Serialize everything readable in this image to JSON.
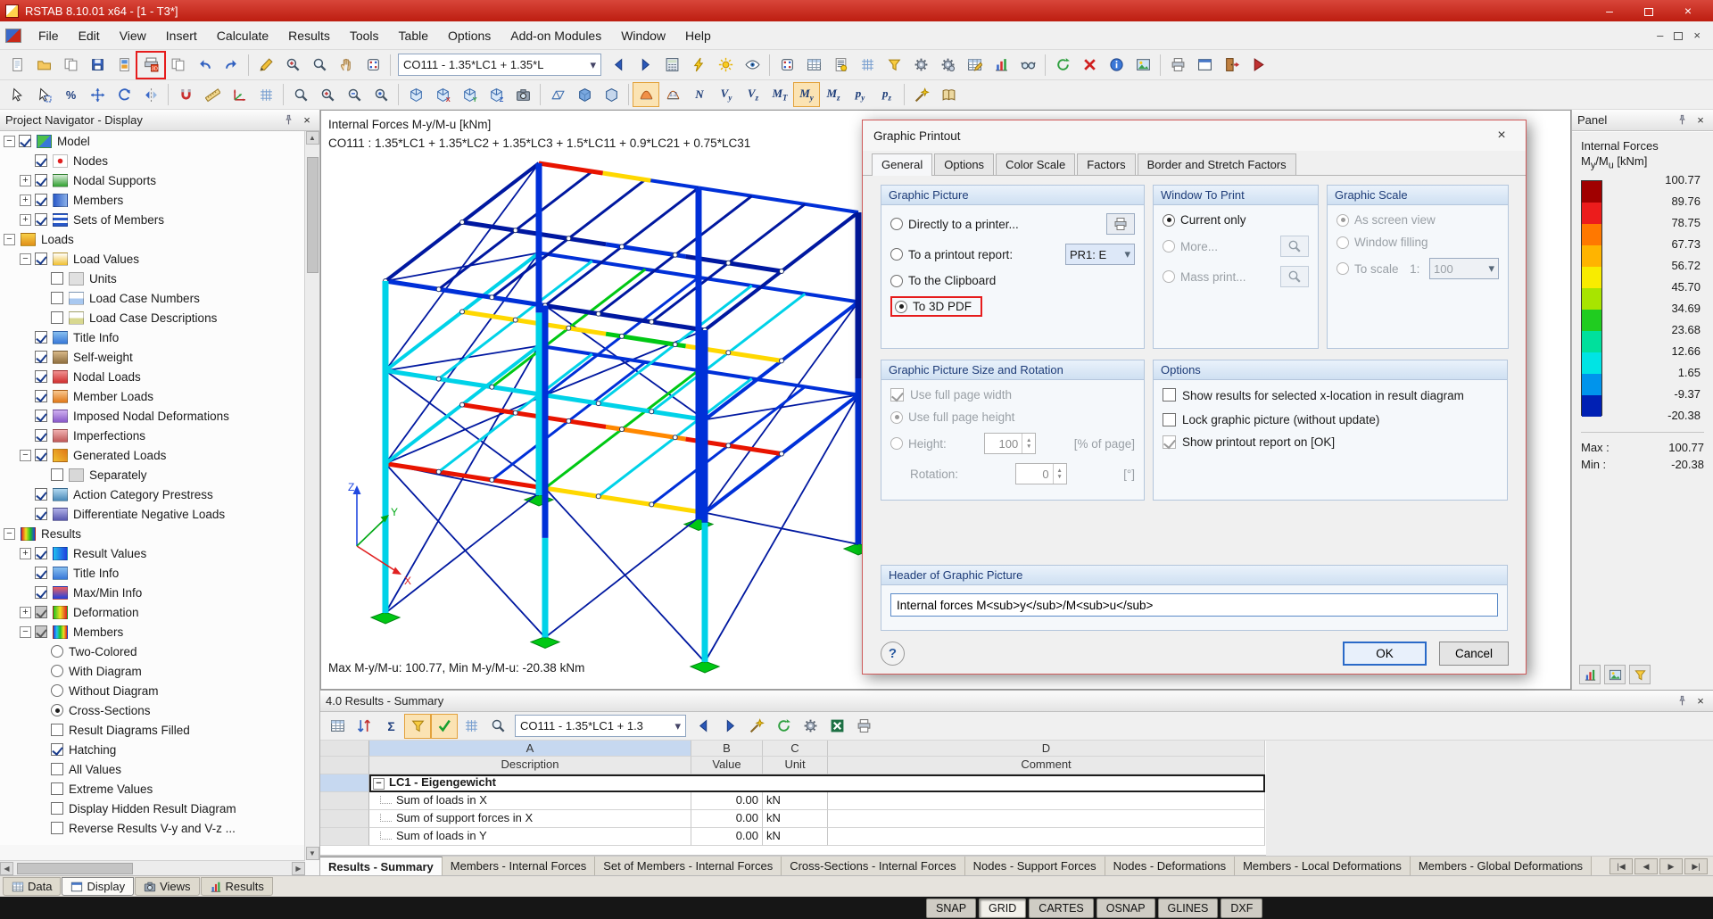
{
  "window": {
    "title": "RSTAB 8.10.01 x64 - [1 - T3*]"
  },
  "glyphs": {
    "close": "×",
    "minimize": "–",
    "dropdown": "▾",
    "left": "◀",
    "right": "▶",
    "up": "▲",
    "down": "▼",
    "plus": "+",
    "minus": "−",
    "help": "?",
    "tab_first": "|◀",
    "tab_prev": "◀",
    "tab_next": "▶",
    "tab_last": "▶|"
  },
  "menu": {
    "items": [
      "File",
      "Edit",
      "View",
      "Insert",
      "Calculate",
      "Results",
      "Tools",
      "Table",
      "Options",
      "Add-on Modules",
      "Window",
      "Help"
    ]
  },
  "toolbar1": [
    {
      "n": "new",
      "t": "page"
    },
    {
      "n": "open",
      "t": "folder"
    },
    {
      "n": "save-as",
      "t": "copy"
    },
    {
      "n": "save",
      "t": "disk"
    },
    {
      "n": "page-preview",
      "t": "pagecol"
    },
    {
      "n": "print-graphic",
      "t": "printg",
      "hl": true
    },
    {
      "n": "copy",
      "t": "copy2"
    },
    {
      "n": "undo",
      "t": "undo"
    },
    {
      "n": "redo",
      "t": "redo"
    },
    {
      "sep": true
    },
    {
      "n": "edit",
      "t": "pencil"
    },
    {
      "n": "zoom-in",
      "t": "magp"
    },
    {
      "n": "zoom-window",
      "t": "mag"
    },
    {
      "n": "pan",
      "t": "hand"
    },
    {
      "n": "numbering",
      "t": "dice"
    },
    {
      "sep": true
    },
    {
      "combo": "CO111 - 1.35*LC1 + 1.35*L"
    },
    {
      "n": "previous-load-case",
      "t": "arrl"
    },
    {
      "n": "next-load-case",
      "t": "arrr"
    },
    {
      "n": "calculation",
      "t": "calc"
    },
    {
      "n": "calculate-all",
      "t": "bolt"
    },
    {
      "n": "show-results",
      "t": "sun"
    },
    {
      "n": "show-result-values",
      "t": "eye"
    },
    {
      "sep": true
    },
    {
      "n": "load-cases",
      "t": "dice2"
    },
    {
      "n": "tables",
      "t": "table"
    },
    {
      "n": "printout-report",
      "t": "report"
    },
    {
      "n": "grid",
      "t": "grid"
    },
    {
      "n": "filter",
      "t": "filter"
    },
    {
      "n": "generate",
      "t": "gear"
    },
    {
      "n": "modules",
      "t": "gear2"
    },
    {
      "n": "edit-table",
      "t": "tablepen"
    },
    {
      "n": "diagram",
      "t": "chart"
    },
    {
      "n": "view-options",
      "t": "glasses"
    },
    {
      "sep": true
    },
    {
      "n": "refresh",
      "t": "refresh"
    },
    {
      "n": "delete-results",
      "t": "xred"
    },
    {
      "n": "info",
      "t": "info"
    },
    {
      "n": "render",
      "t": "img"
    },
    {
      "sep": true
    },
    {
      "n": "print",
      "t": "printer"
    },
    {
      "n": "window-arrange",
      "t": "win"
    },
    {
      "n": "exit",
      "t": "door"
    },
    {
      "n": "run-help",
      "t": "play"
    }
  ],
  "toolbar2": [
    {
      "n": "select",
      "t": "cursor"
    },
    {
      "n": "select-special",
      "t": "cursorbox"
    },
    {
      "n": "scale-percent",
      "t": "percent"
    },
    {
      "n": "move",
      "t": "moveax"
    },
    {
      "n": "rotate",
      "t": "rotate"
    },
    {
      "n": "mirror",
      "t": "mirror"
    },
    {
      "sep": true
    },
    {
      "n": "snap",
      "t": "magnet"
    },
    {
      "n": "guidelines",
      "t": "ruler"
    },
    {
      "n": "work-plane",
      "t": "axes"
    },
    {
      "n": "plane-grid",
      "t": "grid"
    },
    {
      "sep": true
    },
    {
      "n": "zoom",
      "t": "mag"
    },
    {
      "n": "zoom-plus",
      "t": "magp"
    },
    {
      "n": "zoom-minus",
      "t": "magm"
    },
    {
      "n": "previous-view",
      "t": "magl"
    },
    {
      "sep": true
    },
    {
      "n": "isometric-view",
      "t": "cube"
    },
    {
      "n": "view-in-x",
      "t": "cubex"
    },
    {
      "n": "view-in-y",
      "t": "cubey"
    },
    {
      "n": "view-in-z",
      "t": "cubez"
    },
    {
      "n": "user-view",
      "t": "camera"
    },
    {
      "sep": true
    },
    {
      "n": "wireframe-model",
      "t": "wire"
    },
    {
      "n": "solid-model",
      "t": "solid"
    },
    {
      "n": "transparent-model",
      "t": "glassbox"
    },
    {
      "sep": true
    },
    {
      "n": "result-diagrams",
      "t": "rdia",
      "on": true
    },
    {
      "n": "result-values",
      "t": "rval"
    },
    {
      "n": "component-n",
      "text": "N"
    },
    {
      "n": "component-vy",
      "text": "V_y"
    },
    {
      "n": "component-vz",
      "text": "V_z"
    },
    {
      "n": "component-mt",
      "text": "M_T"
    },
    {
      "n": "component-my",
      "text": "M_y",
      "on": true
    },
    {
      "n": "component-mz",
      "text": "M_z"
    },
    {
      "n": "component-py",
      "text": "p_y"
    },
    {
      "n": "component-pz",
      "text": "p_z"
    },
    {
      "sep": true
    },
    {
      "n": "animation",
      "t": "wand"
    },
    {
      "n": "manual",
      "t": "book"
    }
  ],
  "navigator": {
    "title": "Project Navigator - Display",
    "tree": [
      {
        "label": "Model",
        "level": 0,
        "exp": "minus",
        "ctrl": "check",
        "icon": "model"
      },
      {
        "label": "Nodes",
        "level": 1,
        "exp": "none",
        "ctrl": "check",
        "icon": "nodes"
      },
      {
        "label": "Nodal Supports",
        "level": 1,
        "exp": "plus",
        "ctrl": "check",
        "icon": "supports"
      },
      {
        "label": "Members",
        "level": 1,
        "exp": "plus",
        "ctrl": "check",
        "icon": "members"
      },
      {
        "label": "Sets of Members",
        "level": 1,
        "exp": "plus",
        "ctrl": "check",
        "icon": "sets"
      },
      {
        "label": "Loads",
        "level": 0,
        "exp": "minus",
        "ctrl": "none",
        "icon": "loads"
      },
      {
        "label": "Load Values",
        "level": 1,
        "exp": "minus",
        "ctrl": "check",
        "icon": "loadvalues"
      },
      {
        "label": "Units",
        "level": 2,
        "exp": "none",
        "ctrl": "uncheck",
        "icon": "units"
      },
      {
        "label": "Load Case Numbers",
        "level": 2,
        "exp": "none",
        "ctrl": "uncheck",
        "icon": "numbers"
      },
      {
        "label": "Load Case Descriptions",
        "level": 2,
        "exp": "none",
        "ctrl": "uncheck",
        "icon": "descriptions"
      },
      {
        "label": "Title Info",
        "level": 1,
        "exp": "none",
        "ctrl": "check",
        "icon": "info"
      },
      {
        "label": "Self-weight",
        "level": 1,
        "exp": "none",
        "ctrl": "check",
        "icon": "selfweight"
      },
      {
        "label": "Nodal Loads",
        "level": 1,
        "exp": "none",
        "ctrl": "check",
        "icon": "nodalloads"
      },
      {
        "label": "Member Loads",
        "level": 1,
        "exp": "none",
        "ctrl": "check",
        "icon": "memberloads"
      },
      {
        "label": "Imposed Nodal Deformations",
        "level": 1,
        "exp": "none",
        "ctrl": "check",
        "icon": "imposed"
      },
      {
        "label": "Imperfections",
        "level": 1,
        "exp": "none",
        "ctrl": "check",
        "icon": "imperfections"
      },
      {
        "label": "Generated Loads",
        "level": 1,
        "exp": "minus",
        "ctrl": "check",
        "icon": "generated"
      },
      {
        "label": "Separately",
        "level": 2,
        "exp": "none",
        "ctrl": "uncheck",
        "icon": "separately"
      },
      {
        "label": "Action Category Prestress",
        "level": 1,
        "exp": "none",
        "ctrl": "check",
        "icon": "prestress"
      },
      {
        "label": "Differentiate Negative Loads",
        "level": 1,
        "exp": "none",
        "ctrl": "check",
        "icon": "negative"
      },
      {
        "label": "Results",
        "level": 0,
        "exp": "minus",
        "ctrl": "none",
        "icon": "results"
      },
      {
        "label": "Result Values",
        "level": 1,
        "exp": "plus",
        "ctrl": "check",
        "icon": "resultvalues"
      },
      {
        "label": "Title Info",
        "level": 1,
        "exp": "none",
        "ctrl": "check",
        "icon": "info"
      },
      {
        "label": "Max/Min Info",
        "level": 1,
        "exp": "none",
        "ctrl": "check",
        "icon": "maxmin"
      },
      {
        "label": "Deformation",
        "level": 1,
        "exp": "plus",
        "ctrl": "partial",
        "icon": "deformation"
      },
      {
        "label": "Members",
        "level": 1,
        "exp": "minus",
        "ctrl": "partial",
        "icon": "membersres"
      },
      {
        "label": "Two-Colored",
        "level": 2,
        "exp": "none",
        "ctrl": "radio-off",
        "icon": null
      },
      {
        "label": "With Diagram",
        "level": 2,
        "exp": "none",
        "ctrl": "radio-off",
        "icon": null
      },
      {
        "label": "Without Diagram",
        "level": 2,
        "exp": "none",
        "ctrl": "radio-off",
        "icon": null
      },
      {
        "label": "Cross-Sections",
        "level": 2,
        "exp": "none",
        "ctrl": "radio-on",
        "icon": null
      },
      {
        "label": "Result Diagrams Filled",
        "level": 2,
        "exp": "none",
        "ctrl": "uncheck",
        "icon": null
      },
      {
        "label": "Hatching",
        "level": 2,
        "exp": "none",
        "ctrl": "check",
        "icon": null
      },
      {
        "label": "All Values",
        "level": 2,
        "exp": "none",
        "ctrl": "uncheck",
        "icon": null
      },
      {
        "label": "Extreme Values",
        "level": 2,
        "exp": "none",
        "ctrl": "uncheck",
        "icon": null
      },
      {
        "label": "Display Hidden Result Diagram",
        "level": 2,
        "exp": "none",
        "ctrl": "uncheck",
        "icon": null
      },
      {
        "label": "Reverse Results V-y and V-z ...",
        "level": 2,
        "exp": "none",
        "ctrl": "uncheck",
        "icon": null
      }
    ],
    "tabs": [
      {
        "label": "Data",
        "icon": "table"
      },
      {
        "label": "Display",
        "icon": "win",
        "active": true
      },
      {
        "label": "Views",
        "icon": "camera"
      },
      {
        "label": "Results",
        "icon": "chart"
      }
    ]
  },
  "viewport": {
    "info_line1": "Internal Forces M-y/M-u [kNm]",
    "info_line2": "CO111 : 1.35*LC1 + 1.35*LC2 + 1.35*LC3 + 1.5*LC11 + 0.9*LC21 + 0.75*LC31",
    "maxmin": "Max M-y/M-u: 100.77, Min M-y/M-u: -20.38 kNm"
  },
  "dialog": {
    "title": "Graphic Printout",
    "tabs": [
      {
        "label": "General",
        "active": true
      },
      {
        "label": "Options"
      },
      {
        "label": "Color Scale"
      },
      {
        "label": "Factors"
      },
      {
        "label": "Border and Stretch Factors"
      }
    ],
    "graphic_picture": {
      "title": "Graphic Picture",
      "directly": "Directly to a printer...",
      "report": "To a printout report:",
      "report_combo": "PR1: E",
      "clipboard": "To the Clipboard",
      "pdf3d": "To 3D PDF",
      "selected": "To 3D PDF"
    },
    "window_to_print": {
      "title": "Window To Print",
      "current": "Current only",
      "more": "More...",
      "mass": "Mass print...",
      "selected": "Current only"
    },
    "graphic_scale": {
      "title": "Graphic Scale",
      "screen": "As screen view",
      "filling": "Window filling",
      "scale": "To scale",
      "ratio": "1:",
      "value": "100",
      "selected": "As screen view"
    },
    "size_rotation": {
      "title": "Graphic Picture Size and Rotation",
      "full_width": "Use full page width",
      "full_height": "Use full page height",
      "height": "Height:",
      "height_value": "100",
      "height_unit": "[% of page]",
      "rotation": "Rotation:",
      "rotation_value": "0",
      "rotation_unit": "[°]"
    },
    "options": {
      "title": "Options",
      "xloc": "Show results for selected x-location in result diagram",
      "lock": "Lock graphic picture (without update)",
      "report_ok": "Show printout report on [OK]"
    },
    "header": {
      "title": "Header of Graphic Picture",
      "value": "Internal forces M<sub>y</sub>/M<sub>u</sub>"
    },
    "ok": "OK",
    "cancel": "Cancel"
  },
  "panel": {
    "title": "Panel",
    "result_type": "Internal Forces",
    "comp": {
      "m1": "M",
      "s1": "y",
      "m2": "/M",
      "s2": "u",
      "unit": " [kNm]"
    },
    "legend": {
      "labels": [
        "100.77",
        "89.76",
        "78.75",
        "67.73",
        "56.72",
        "45.70",
        "34.69",
        "23.68",
        "12.66",
        "1.65",
        "-9.37",
        "-20.38"
      ],
      "colors": [
        "#a00000",
        "#ec1c1c",
        "#ff7800",
        "#ffb400",
        "#f8ec00",
        "#a8e400",
        "#20cc20",
        "#00e09c",
        "#00e4e4",
        "#0094ec",
        "#0020b4"
      ]
    },
    "max_label": "Max :",
    "max_value": "100.77",
    "min_label": "Min :",
    "min_value": "-20.38",
    "buttons": [
      {
        "n": "panel-color-scale",
        "t": "chart"
      },
      {
        "n": "panel-display-options",
        "t": "img"
      },
      {
        "n": "panel-filter",
        "t": "filter"
      }
    ]
  },
  "results_pane": {
    "title": "4.0 Results - Summary",
    "toolbar": [
      {
        "n": "goto-table",
        "t": "table"
      },
      {
        "n": "sort-results",
        "t": "sort"
      },
      {
        "n": "sum-check",
        "t": "sigma"
      },
      {
        "n": "filter-rows",
        "t": "filter",
        "on": true
      },
      {
        "n": "highlight-results",
        "t": "check",
        "on": true
      },
      {
        "n": "column-settings",
        "t": "grid"
      },
      {
        "n": "find-in-table",
        "t": "mag"
      },
      {
        "combo": "CO111 - 1.35*LC1 + 1.3"
      },
      {
        "n": "previous-table",
        "t": "arrl"
      },
      {
        "n": "next-table",
        "t": "arrr"
      },
      {
        "n": "sync-graphic",
        "t": "wand"
      },
      {
        "n": "refresh-table",
        "t": "refresh"
      },
      {
        "n": "table-settings",
        "t": "gear"
      },
      {
        "n": "export-excel",
        "t": "excel"
      },
      {
        "n": "print-table",
        "t": "printer"
      }
    ],
    "table": {
      "letters": [
        "A",
        "B",
        "C",
        "D"
      ],
      "headers": [
        "Description",
        "Value",
        "Unit",
        "Comment"
      ],
      "group_row": "LC1 - Eigengewicht",
      "rows": [
        {
          "desc": "Sum of loads in X",
          "value": "0.00",
          "unit": "kN",
          "comment": ""
        },
        {
          "desc": "Sum of support forces in X",
          "value": "0.00",
          "unit": "kN",
          "comment": ""
        },
        {
          "desc": "Sum of loads in Y",
          "value": "0.00",
          "unit": "kN",
          "comment": ""
        }
      ]
    },
    "tabs": [
      "Results - Summary",
      "Members - Internal Forces",
      "Set of Members - Internal Forces",
      "Cross-Sections - Internal Forces",
      "Nodes - Support Forces",
      "Nodes - Deformations",
      "Members - Local Deformations",
      "Members - Global Deformations"
    ]
  },
  "statusbar": {
    "buttons": [
      {
        "label": "SNAP"
      },
      {
        "label": "GRID",
        "active": true
      },
      {
        "label": "CARTES"
      },
      {
        "label": "OSNAP"
      },
      {
        "label": "GLINES"
      },
      {
        "label": "DXF"
      }
    ]
  }
}
